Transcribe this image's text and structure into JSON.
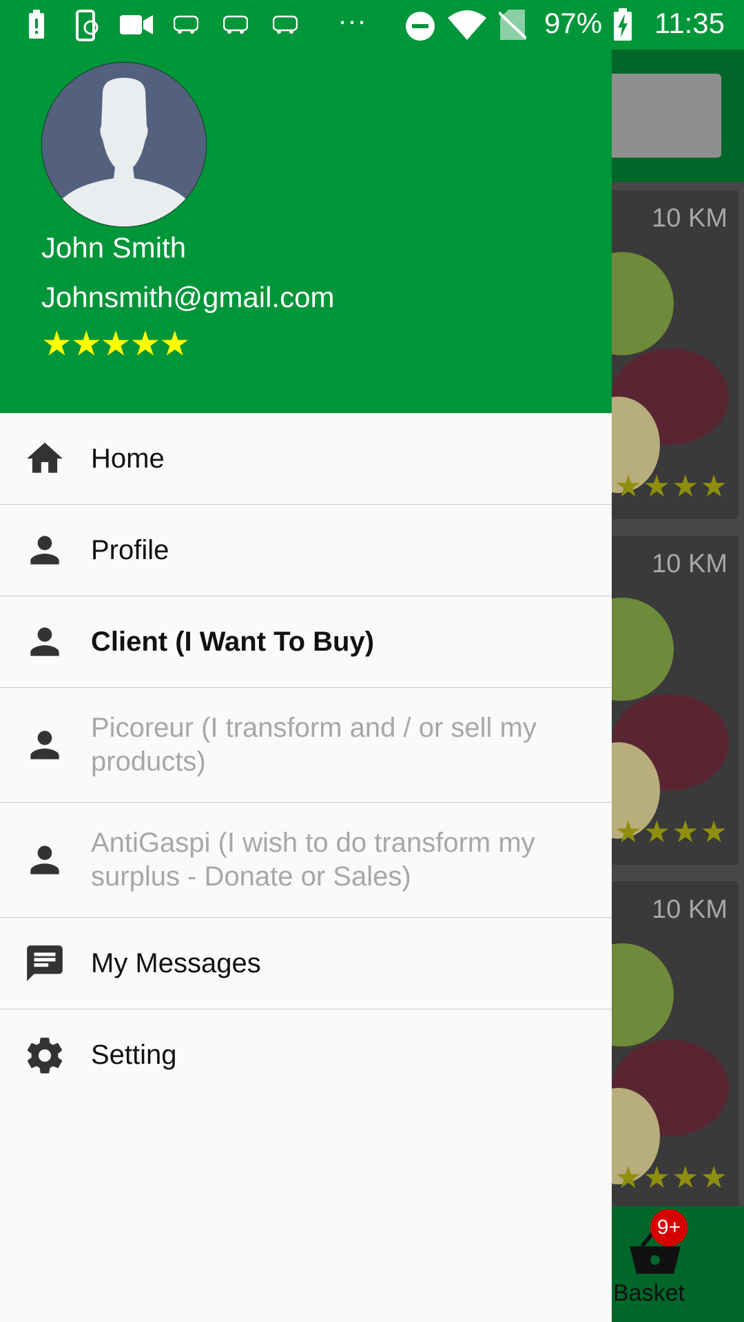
{
  "status_bar": {
    "battery_percent": "97%",
    "time": "11:35",
    "overflow": "···",
    "icons": [
      "battery-saver-icon",
      "phone-sync-icon",
      "video-icon",
      "redbus-icon",
      "redbus-icon",
      "redbus-icon",
      "do-not-disturb-icon",
      "wifi-icon",
      "no-sim-icon",
      "battery-charging-icon"
    ]
  },
  "drawer": {
    "header": {
      "name": "John Smith",
      "email": "Johnsmith@gmail.com",
      "rating": 5,
      "stars": "★★★★★"
    },
    "items": [
      {
        "label": "Home",
        "icon": "home-icon",
        "style": "normal"
      },
      {
        "label": "Profile",
        "icon": "person-icon",
        "style": "normal"
      },
      {
        "label": "Client (I Want To Buy)",
        "icon": "person-icon",
        "style": "bold"
      },
      {
        "label": "Picoreur (I transform and / or sell my products)",
        "icon": "person-icon",
        "style": "disabled"
      },
      {
        "label": "AntiGaspi (I wish to do transform my surplus - Donate or Sales)",
        "icon": "person-icon",
        "style": "disabled"
      },
      {
        "label": "My Messages",
        "icon": "message-icon",
        "style": "normal"
      },
      {
        "label": "Setting",
        "icon": "gear-icon",
        "style": "normal"
      }
    ]
  },
  "background": {
    "cards": [
      {
        "distance": "10 KM",
        "stars": "★★★★"
      },
      {
        "distance": "10 KM",
        "stars": "★★★★"
      },
      {
        "distance": "10 KM",
        "stars": "★★★★"
      }
    ],
    "bottom_nav": {
      "basket_label": "Basket",
      "badge": "9+"
    }
  },
  "colors": {
    "primary": "#009639",
    "dark_primary": "#00662a",
    "star": "#ffff00",
    "badge": "#d60000"
  }
}
